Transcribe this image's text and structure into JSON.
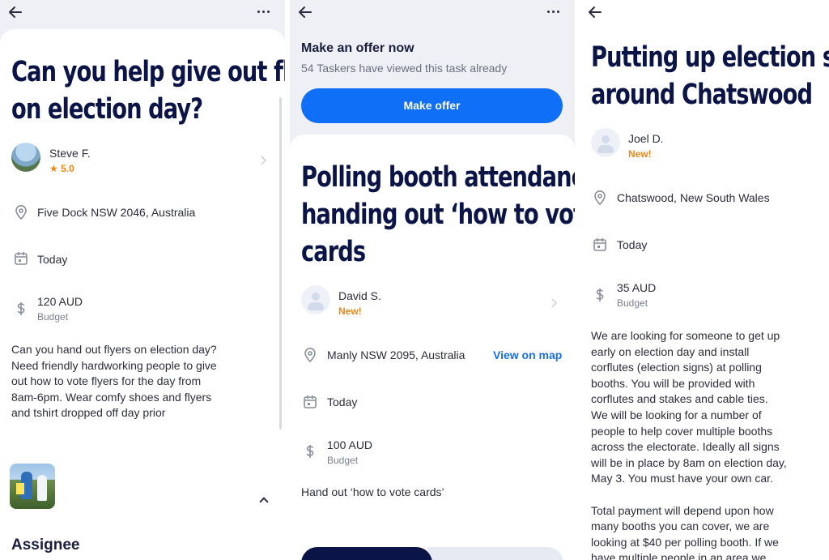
{
  "screen1": {
    "title_lines": [
      "Can you help give out flyers",
      "on election day?"
    ],
    "poster": {
      "name": "Steve F.",
      "rating": "★ 5.0"
    },
    "location": "Five Dock NSW 2046, Australia",
    "date": "Today",
    "budget": {
      "amount": "120 AUD",
      "label": "Budget"
    },
    "description": "Can you hand out flyers on election day? Need friendly hardworking people to give out how to vote flyers for the day from 8am-6pm. Wear comfy shoes and flyers and tshirt dropped off day prior",
    "assignee_heading": "Assignee",
    "icons": {
      "back": "arrow-left-icon",
      "more": "more-dots-icon",
      "location": "location-pin-icon",
      "calendar": "calendar-icon",
      "budget": "dollar-icon"
    }
  },
  "screen2": {
    "offer_heading": "Make an offer now",
    "viewed_text": "54 Taskers have viewed this task already",
    "cta_label": "Make offer",
    "title_lines": [
      "Polling booth attendance–",
      "handing out ‘how to vote’",
      "cards"
    ],
    "poster": {
      "name": "David S.",
      "badge": "New!"
    },
    "location": "Manly NSW 2095, Australia",
    "map_link": "View on map",
    "date": "Today",
    "budget": {
      "amount": "100 AUD",
      "label": "Budget"
    },
    "description": "Hand out ‘how to vote cards’"
  },
  "screen3": {
    "title_lines": [
      "Putting up election signs",
      "around Chatswood"
    ],
    "poster": {
      "name": "Joel D.",
      "badge": "New!"
    },
    "location": "Chatswood, New South Wales",
    "date": "Today",
    "budget": {
      "amount": "35 AUD",
      "label": "Budget"
    },
    "description_lines": [
      "We are looking for someone to get up",
      "early on election day and install",
      "corflutes (election signs) at polling",
      "booths. You will be provided with",
      "corflutes and stakes and cable ties.",
      "We will be looking for a number of",
      "people to help cover multiple booths",
      "across the electorate. Ideally all signs",
      "will be in place by 8am on election day,",
      "May 3. You must have your own car.",
      "",
      "Total payment will depend upon how",
      "many booths you can cover, we are",
      "looking at $40 per polling booth. If we",
      "have multiple people in an area we"
    ]
  },
  "colors": {
    "navy": "#0b1447",
    "accent": "#0f6ff6",
    "badge": "#e8881a",
    "link": "#1a6fe6"
  }
}
